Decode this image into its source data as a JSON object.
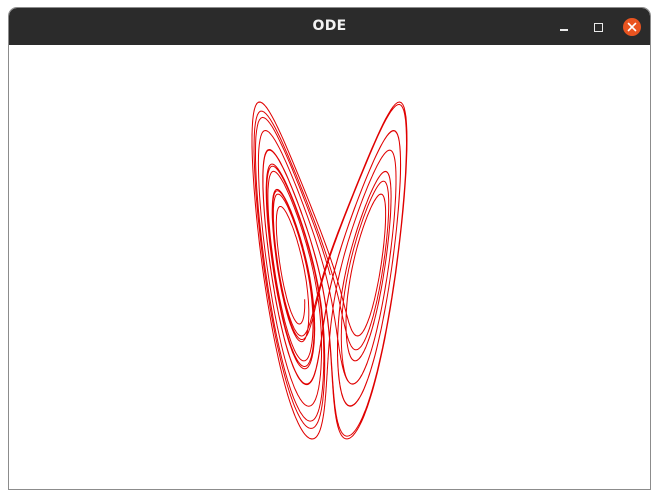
{
  "window": {
    "title": "ODE",
    "controls": {
      "minimize_icon": "minimize-icon",
      "maximize_icon": "maximize-icon",
      "close_icon": "close-icon"
    },
    "colors": {
      "titlebar": "#2b2b2b",
      "title_text": "#f2f2f2",
      "close_button": "#e95420",
      "canvas_background": "#ffffff"
    }
  },
  "plot": {
    "curve_color": "#e00000"
  }
}
